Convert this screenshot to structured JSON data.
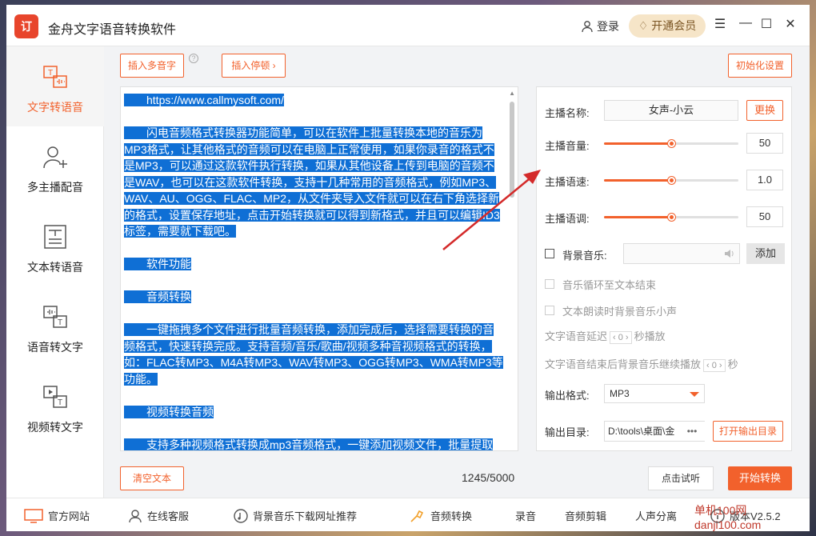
{
  "app": {
    "logo_text": "订",
    "title": "金舟文字语音转换软件",
    "login_label": "登录",
    "vip_label": "开通会员",
    "menu_glyph": "☰",
    "minimize_glyph": "—",
    "maximize_glyph": "☐",
    "close_glyph": "✕"
  },
  "sidebar": {
    "items": [
      {
        "label": "文字转语音",
        "icon": "text-to-speech-icon",
        "active": true
      },
      {
        "label": "多主播配音",
        "icon": "add-user-icon",
        "active": false
      },
      {
        "label": "文本转语音",
        "icon": "document-icon",
        "active": false
      },
      {
        "label": "语音转文字",
        "icon": "speech-to-text-icon",
        "active": false
      },
      {
        "label": "视频转文字",
        "icon": "video-to-text-icon",
        "active": false
      }
    ]
  },
  "toolbar": {
    "insert_polyphone": "插入多音字",
    "help_glyph": "?",
    "insert_pause": "插入停顿 ›",
    "reset_settings": "初始化设置"
  },
  "editor": {
    "paragraphs": [
      "　　https://www.callmysoft.com/",
      "　　闪电音频格式转换器功能简单，可以在软件上批量转换本地的音乐为MP3格式，让其他格式的音频可以在电脑上正常使用，如果你录音的格式不是MP3，可以通过这款软件执行转换，如果从其他设备上传到电脑的音频不是WAV，也可以在这款软件转换，支持十几种常用的音频格式，例如MP3、WAV、AU、OGG、FLAC、MP2，从文件夹导入文件就可以在右下角选择新的格式，设置保存地址，点击开始转换就可以得到新格式，并且可以编辑ID3标签，需要就下载吧。",
      "　　软件功能",
      "　　音频转换",
      "　　一键拖拽多个文件进行批量音频转换，添加完成后，选择需要转换的音频格式，快速转换完成。支持音频/音乐/歌曲/视频多种音视频格式的转换，如：FLAC转MP3、M4A转MP3、WAV转MP3、OGG转MP3、WMA转MP3等功能。",
      "　　视频转换音频",
      "　　支持多种视频格式转换成mp3音频格式，一键添加视频文件，批量提取"
    ],
    "clear_button": "清空文本",
    "counter": "1245/5000"
  },
  "settings": {
    "anchor_name_label": "主播名称:",
    "anchor_name_value": "女声-小云",
    "change_button": "更换",
    "volume_label": "主播音量:",
    "volume_value": "50",
    "volume_fraction": 0.5,
    "speed_label": "主播语速:",
    "speed_value": "1.0",
    "speed_fraction": 0.5,
    "pitch_label": "主播语调:",
    "pitch_value": "50",
    "pitch_fraction": 0.5,
    "bg_music_label": "背景音乐:",
    "add_button": "添加",
    "loop_label": "音乐循环至文本结束",
    "quiet_label": "文本朗读时背景音乐小声",
    "delay_prefix": "文字语音延迟",
    "delay_value": "0",
    "delay_suffix": "秒播放",
    "continue_prefix": "文字语音结束后背景音乐继续播放",
    "continue_value": "0",
    "continue_suffix": "秒",
    "format_label": "输出格式:",
    "format_value": "MP3",
    "dir_label": "输出目录:",
    "dir_value": "D:\\tools\\桌面\\金",
    "dir_more": "•••",
    "open_dir_button": "打开输出目录"
  },
  "actions": {
    "preview_button": "点击试听",
    "start_button": "开始转换"
  },
  "bottombar": {
    "items": [
      {
        "label": "官方网站",
        "icon": "monitor-icon"
      },
      {
        "label": "在线客服",
        "icon": "support-icon"
      },
      {
        "label": "背景音乐下载网址推荐",
        "icon": "music-note-icon"
      },
      {
        "label": "音频转换",
        "icon": "tools-icon"
      },
      {
        "label": "录音",
        "icon": ""
      },
      {
        "label": "音频剪辑",
        "icon": ""
      },
      {
        "label": "人声分离",
        "icon": ""
      },
      {
        "label": "版本V2.5.2",
        "icon": "info-icon"
      }
    ]
  },
  "watermark": "单机100网 danji100.com",
  "colors": {
    "accent": "#f2612c",
    "selection": "#0f6fd5",
    "logo": "#e8452c",
    "arrow": "#d42a2a"
  }
}
